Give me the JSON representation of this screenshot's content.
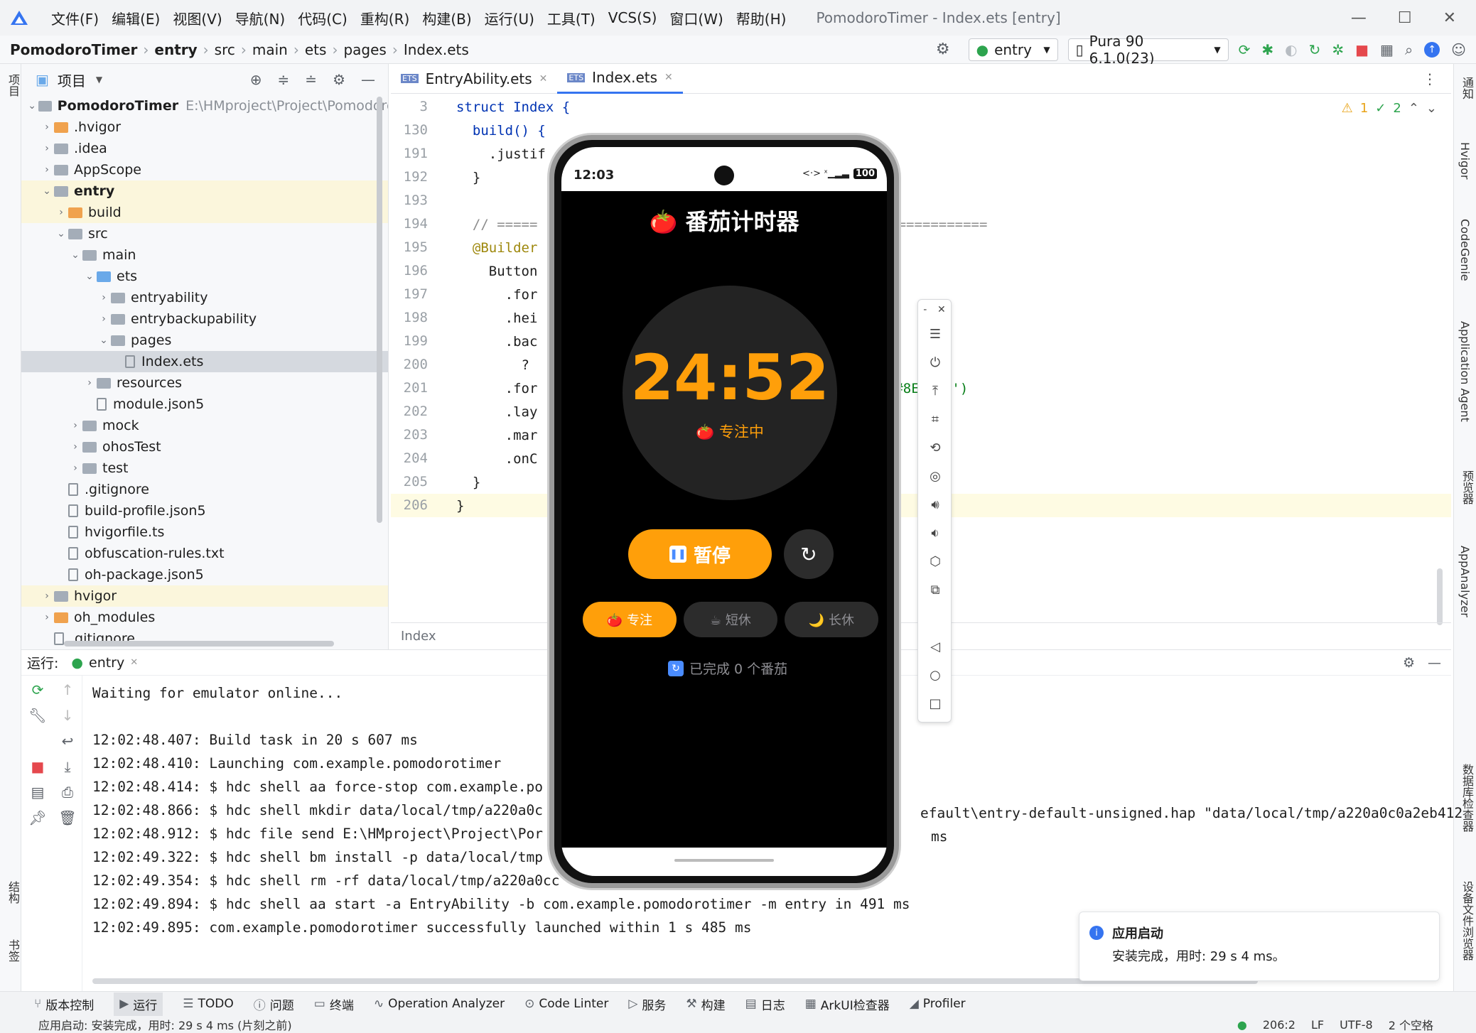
{
  "window": {
    "menus": [
      "文件(F)",
      "编辑(E)",
      "视图(V)",
      "导航(N)",
      "代码(C)",
      "重构(R)",
      "构建(B)",
      "运行(U)",
      "工具(T)",
      "VCS(S)",
      "窗口(W)",
      "帮助(H)"
    ],
    "title": "PomodoroTimer - Index.ets [entry]"
  },
  "breadcrumb": [
    "PomodoroTimer",
    "entry",
    "src",
    "main",
    "ets",
    "pages",
    "Index.ets"
  ],
  "toolbar": {
    "module": "entry",
    "device": "Pura 90 6.1.0(23)"
  },
  "left_strip": [
    "项目",
    "结构",
    "书签"
  ],
  "right_strip": [
    "通知",
    "Hvigor",
    "CodeGenie",
    "Application Agent",
    "预览器",
    "AppAnalyzer",
    "数据库检查器",
    "设备文件浏览器"
  ],
  "project": {
    "header": "项目",
    "tree": [
      {
        "label": "PomodoroTimer",
        "extra": "E:\\HMproject\\Project\\PomodoroTi",
        "level": 0,
        "type": "folder",
        "open": true,
        "bold": true
      },
      {
        "label": ".hvigor",
        "level": 1,
        "type": "folder-orange",
        "open": false
      },
      {
        "label": ".idea",
        "level": 1,
        "type": "folder",
        "open": false
      },
      {
        "label": "AppScope",
        "level": 1,
        "type": "folder",
        "open": false
      },
      {
        "label": "entry",
        "level": 1,
        "type": "folder",
        "open": true,
        "bold": true
      },
      {
        "label": "build",
        "level": 2,
        "type": "folder-orange",
        "open": false
      },
      {
        "label": "src",
        "level": 2,
        "type": "folder",
        "open": true
      },
      {
        "label": "main",
        "level": 3,
        "type": "folder",
        "open": true
      },
      {
        "label": "ets",
        "level": 4,
        "type": "folder-blue",
        "open": true
      },
      {
        "label": "entryability",
        "level": 5,
        "type": "folder",
        "open": false
      },
      {
        "label": "entrybackupability",
        "level": 5,
        "type": "folder",
        "open": false
      },
      {
        "label": "pages",
        "level": 5,
        "type": "folder",
        "open": true
      },
      {
        "label": "Index.ets",
        "level": 6,
        "type": "file",
        "selected": true
      },
      {
        "label": "resources",
        "level": 4,
        "type": "folder",
        "open": false
      },
      {
        "label": "module.json5",
        "level": 4,
        "type": "file"
      },
      {
        "label": "mock",
        "level": 3,
        "type": "folder",
        "open": false
      },
      {
        "label": "ohosTest",
        "level": 3,
        "type": "folder",
        "open": false
      },
      {
        "label": "test",
        "level": 3,
        "type": "folder",
        "open": false
      },
      {
        "label": ".gitignore",
        "level": 2,
        "type": "file"
      },
      {
        "label": "build-profile.json5",
        "level": 2,
        "type": "file"
      },
      {
        "label": "hvigorfile.ts",
        "level": 2,
        "type": "file"
      },
      {
        "label": "obfuscation-rules.txt",
        "level": 2,
        "type": "file"
      },
      {
        "label": "oh-package.json5",
        "level": 2,
        "type": "file"
      },
      {
        "label": "hvigor",
        "level": 1,
        "type": "folder",
        "open": false
      },
      {
        "label": "oh_modules",
        "level": 1,
        "type": "folder-orange",
        "open": false
      },
      {
        "label": ".gitignore",
        "level": 1,
        "type": "file"
      }
    ]
  },
  "editor": {
    "tabs": [
      "EntryAbility.ets",
      "Index.ets"
    ],
    "warnings": "1",
    "checks": "2",
    "breadcrumb_footer": "Index",
    "lines": [
      {
        "n": "3",
        "code": "struct Index {"
      },
      {
        "n": "130",
        "code": "  build() {"
      },
      {
        "n": "191",
        "code": "    .justif"
      },
      {
        "n": "192",
        "code": "  }"
      },
      {
        "n": "193",
        "code": ""
      },
      {
        "n": "194",
        "code": "  // ====="
      },
      {
        "n": "195",
        "code": "  @Builder"
      },
      {
        "n": "196",
        "code": "    Button"
      },
      {
        "n": "197",
        "code": "      .for"
      },
      {
        "n": "198",
        "code": "      .hei"
      },
      {
        "n": "199",
        "code": "      .bac"
      },
      {
        "n": "200",
        "code": "        ?"
      },
      {
        "n": "201",
        "code": "      .for"
      },
      {
        "n": "202",
        "code": "      .lay"
      },
      {
        "n": "203",
        "code": "      .mar"
      },
      {
        "n": "204",
        "code": "      .onC"
      },
      {
        "n": "205",
        "code": "  }"
      },
      {
        "n": "206",
        "code": "}"
      }
    ],
    "line194_tail": "================",
    "line195_tail": "{",
    "line201_tail": "Wh    : '#8E8E93')"
  },
  "run": {
    "label": "运行:",
    "tab": "entry",
    "log": [
      "Waiting for emulator online...",
      "",
      "12:02:48.407: Build task in 20 s 607 ms",
      "12:02:48.410: Launching com.example.pomodorotimer",
      "12:02:48.414: $ hdc shell aa force-stop com.example.po",
      "12:02:48.866: $ hdc shell mkdir data/local/tmp/a220a0c",
      "12:02:48.912: $ hdc file send E:\\HMproject\\Project\\Por",
      "12:02:49.322: $ hdc shell bm install -p data/local/tmp",
      "12:02:49.354: $ hdc shell rm -rf data/local/tmp/a220a0cc",
      "12:02:49.894: $ hdc shell aa start -a EntryAbility -b com.example.pomodorotimer -m entry in 491 ms",
      "12:02:49.895: com.example.pomodorotimer successfully launched within 1 s 485 ms"
    ],
    "log_tail_912": "efault\\entry-default-unsigned.hap \"data/local/tmp/a220a0c0a2eb412",
    "log_tail_322": "ms"
  },
  "notification": {
    "title": "应用启动",
    "body": "安装完成，用时: 29 s 4 ms。"
  },
  "bottom_tabs": [
    "版本控制",
    "运行",
    "TODO",
    "问题",
    "终端",
    "Operation Analyzer",
    "Code Linter",
    "服务",
    "构建",
    "日志",
    "ArkUI检查器",
    "Profiler"
  ],
  "status": {
    "message": "应用启动: 安装完成，用时: 29 s 4 ms   (片刻之前)",
    "position": "206:2",
    "line_sep": "LF",
    "encoding": "UTF-8",
    "indent": "2 个空格"
  },
  "phone": {
    "time": "12:03",
    "battery": "100",
    "app_title": "🍅 番茄计时器",
    "timer": "24:52",
    "state": "🍅 专注中",
    "pause_label": "暂停",
    "modes": [
      "🍅 专注",
      "☕ 短休",
      "🌙 长休"
    ],
    "completed": "已完成 0 个番茄"
  },
  "colors": {
    "accent": "#FF9F0A",
    "ide_blue": "#3574F0",
    "keyword": "#0033B3",
    "string": "#067D17",
    "comment": "#8C8C8C"
  }
}
